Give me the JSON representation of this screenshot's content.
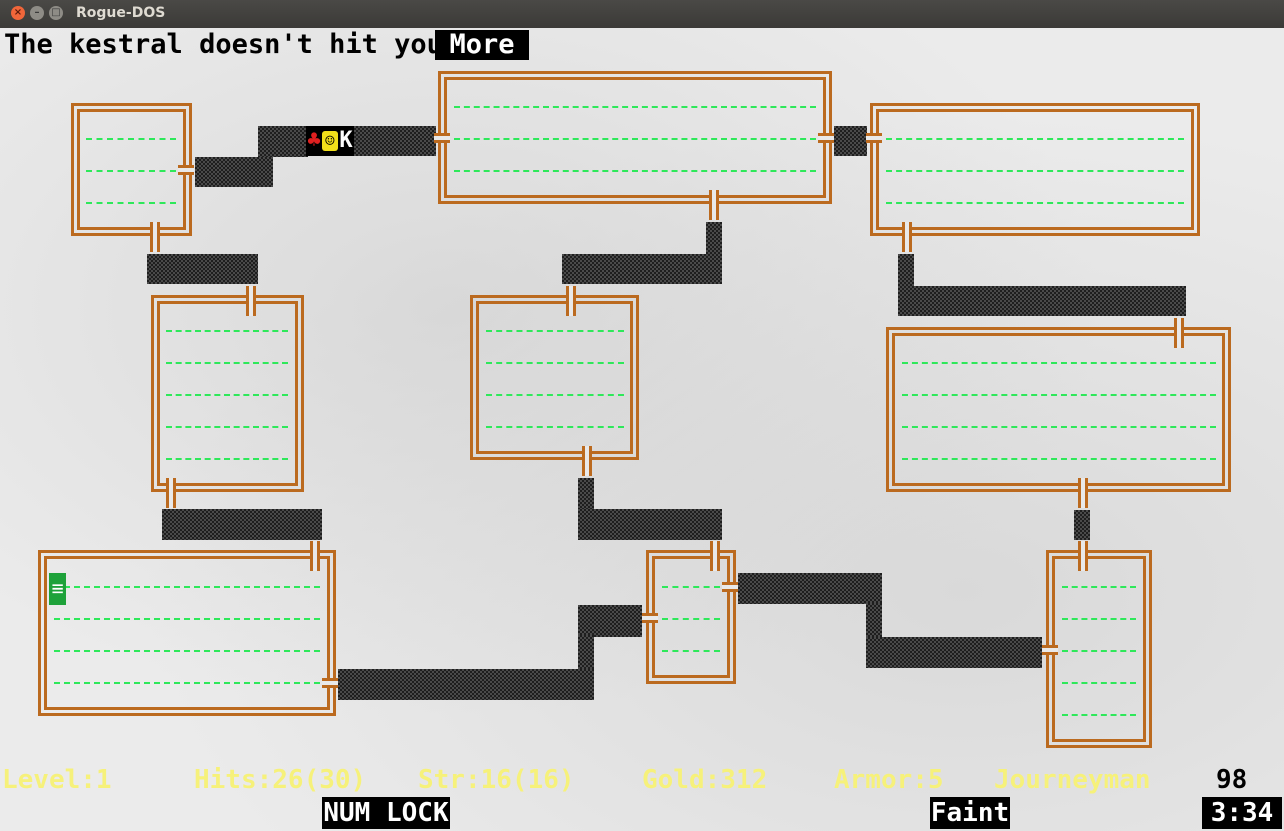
{
  "window": {
    "title": "Rogue-DOS"
  },
  "message": {
    "text": "The kestral doesn't hit you",
    "more_label": "More"
  },
  "actors": {
    "amulet_glyph": "♣",
    "player_glyph": "☺",
    "monster_glyph": "K"
  },
  "stairs_glyph": "≡",
  "status": {
    "level": "Level:1",
    "hits": "Hits:26(30)",
    "str": "Str:16(16)",
    "gold": "Gold:312",
    "armor": "Armor:5",
    "rank": "Journeyman",
    "turns": "98"
  },
  "bottom": {
    "num_lock": "NUM LOCK",
    "hunger": "Faint",
    "clock": "3:34"
  },
  "colors": {
    "wall": "#bb6a1f",
    "floor_dots": "#2ee85a",
    "status_text": "#f6f17a",
    "stairs": "#1ea23a"
  }
}
